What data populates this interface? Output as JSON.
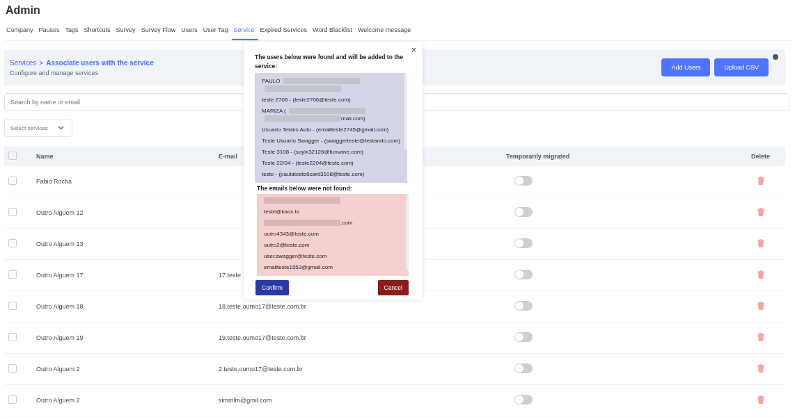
{
  "page": {
    "title": "Admin"
  },
  "tabs": [
    {
      "label": "Company",
      "selected": false
    },
    {
      "label": "Pauses",
      "selected": false
    },
    {
      "label": "Tags",
      "selected": false
    },
    {
      "label": "Shortcuts",
      "selected": false
    },
    {
      "label": "Survey",
      "selected": false
    },
    {
      "label": "Survey Flow",
      "selected": false
    },
    {
      "label": "Users",
      "selected": false
    },
    {
      "label": "User Tag",
      "selected": false
    },
    {
      "label": "Service",
      "selected": true
    },
    {
      "label": "Expired Services",
      "selected": false
    },
    {
      "label": "Word Blacklist",
      "selected": false
    },
    {
      "label": "Welcome message",
      "selected": false
    }
  ],
  "header": {
    "breadcrumb_parent": "Services",
    "breadcrumb_separator": ">",
    "breadcrumb_current": "Associate users with the service",
    "subtitle": "Configure and manage services",
    "buttons": [
      "Add Users",
      "Upload CSV"
    ]
  },
  "search": {
    "placeholder": "Search by name or email"
  },
  "filter": {
    "placeholder": "Select services"
  },
  "table": {
    "all_checked": false,
    "columns": [
      "Name",
      "E-mail",
      "Temporarily migrated",
      "Delete"
    ],
    "rows": [
      {
        "name": "Fabio Rocha",
        "migrated": false,
        "checked": false
      },
      {
        "name": "Outro Alguem 12",
        "migrated": false,
        "checked": false
      },
      {
        "name": "Outro Alguem 13",
        "migrated": false,
        "checked": false
      },
      {
        "name": "Outro Alguem 17",
        "email": "17.teste",
        "migrated": false,
        "checked": false
      },
      {
        "name": "Outro Alguem 18",
        "email": "18.teste.oumo17@teste.com.br",
        "migrated": false,
        "checked": false
      },
      {
        "name": "Outro Alguem 19",
        "email": "19.teste.oumo17@teste.com.br",
        "migrated": false,
        "checked": false
      },
      {
        "name": "Outro Alguem 2",
        "email": "2.teste.oumo17@teste.com.br",
        "migrated": false,
        "checked": false
      },
      {
        "name": "Outro Alguem 2",
        "email": "simmlm@gmil.com",
        "migrated": false,
        "checked": false
      }
    ]
  },
  "dialog": {
    "close": "×",
    "found_title": "The users below were found and will be added to the service:",
    "found_users": [
      {
        "segments": [
          {
            "kind": "text",
            "text": "PAULO"
          },
          {
            "kind": "redacted"
          },
          {
            "kind": "redacted"
          }
        ]
      },
      {
        "segments": [
          {
            "kind": "text",
            "text": "teste 2706 - (teste2706@teste.com)"
          }
        ]
      },
      {
        "segments": [
          {
            "kind": "text",
            "text": "MARIZA ("
          },
          {
            "kind": "redacted"
          },
          {
            "kind": "redacted"
          },
          {
            "kind": "text",
            "text": "mail.com)"
          }
        ]
      },
      {
        "segments": [
          {
            "kind": "text",
            "text": "Usuario Testes Auto - (emailteste2745@gmail.com)"
          }
        ]
      },
      {
        "segments": [
          {
            "kind": "text",
            "text": "Teste Usuario Swagger - (swaggerteste@testando.com)"
          }
        ]
      },
      {
        "segments": [
          {
            "kind": "text",
            "text": "Teste 3108 - (soyix32126@funvane.com)"
          }
        ]
      },
      {
        "segments": [
          {
            "kind": "text",
            "text": "Teste 22/04 - (teste2204@teste.com)"
          }
        ]
      },
      {
        "segments": [
          {
            "kind": "text",
            "text": "teste - (paulateste6card3108@teste.com)"
          }
        ]
      }
    ],
    "not_found_title": "The emails below were not found:",
    "not_found_emails": [
      {
        "segments": [
          {
            "kind": "redacted"
          }
        ]
      },
      {
        "segments": [
          {
            "kind": "text",
            "text": "teste@kaox.tv"
          }
        ]
      },
      {
        "segments": [
          {
            "kind": "redacted"
          },
          {
            "kind": "text",
            "text": ".com"
          }
        ]
      },
      {
        "segments": [
          {
            "kind": "text",
            "text": "outro4343@teste.com"
          }
        ]
      },
      {
        "segments": [
          {
            "kind": "text",
            "text": "outro2@teste.com"
          }
        ]
      },
      {
        "segments": [
          {
            "kind": "text",
            "text": "user.swagger@teste.com"
          }
        ]
      },
      {
        "segments": [
          {
            "kind": "text",
            "text": "emailteste1553@gmail.com"
          }
        ]
      }
    ],
    "confirm": "Confirm",
    "cancel": "Cancel"
  }
}
